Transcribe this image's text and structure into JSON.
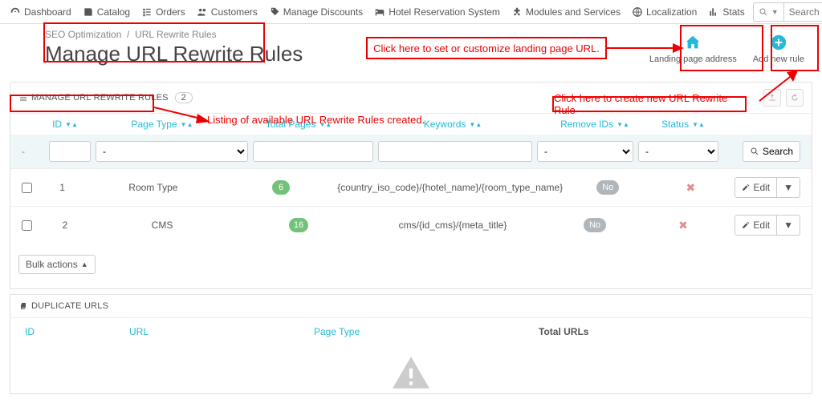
{
  "nav": {
    "dashboard": "Dashboard",
    "catalog": "Catalog",
    "orders": "Orders",
    "customers": "Customers",
    "discounts": "Manage Discounts",
    "hotel": "Hotel Reservation System",
    "modules": "Modules and Services",
    "localization": "Localization",
    "stats": "Stats",
    "search_placeholder": "Search"
  },
  "crumbs": {
    "a": "SEO Optimization",
    "sep": "/",
    "b": "URL Rewrite Rules"
  },
  "title": "Manage URL Rewrite Rules",
  "actions": {
    "landing": "Landing page address",
    "add": "Add new rule"
  },
  "panel1": {
    "title": "MANAGE URL REWRITE RULES",
    "count": "2",
    "cols": {
      "id": "ID",
      "type": "Page Type",
      "pages": "Total Pages",
      "kw": "Keywords",
      "rem": "Remove IDs",
      "stat": "Status"
    },
    "filter_dash": "-",
    "search_btn": "Search",
    "rows": [
      {
        "id": "1",
        "type": "Room Type",
        "pages": "6",
        "kw": "{country_iso_code}/{hotel_name}/{room_type_name}",
        "rem": "No"
      },
      {
        "id": "2",
        "type": "CMS",
        "pages": "16",
        "kw": "cms/{id_cms}/{meta_title}",
        "rem": "No"
      }
    ],
    "edit": "Edit",
    "bulk": "Bulk actions"
  },
  "panel2": {
    "title": "DUPLICATE URLS",
    "cols": {
      "id": "ID",
      "url": "URL",
      "pt": "Page Type",
      "tot": "Total URLs"
    }
  },
  "annot": {
    "a1": "Click here to set or customize landing page URL.",
    "a2": "Click here to create new URL Rewrite Rule",
    "a3": "Listing of available URL Rewrite Rules created."
  }
}
